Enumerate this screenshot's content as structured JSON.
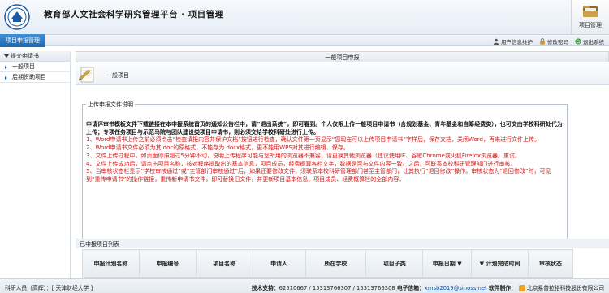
{
  "header": {
    "title": "教育部人文社会科学研究管理平台 · 项目管理",
    "module_button_label": "项目管理"
  },
  "nav": {
    "active_tab": "项目申报管理",
    "links": [
      {
        "label": "用户信息维护",
        "icon": "user-icon"
      },
      {
        "label": "修改密码",
        "icon": "lock-icon"
      },
      {
        "label": "退出系统",
        "icon": "power-icon"
      }
    ]
  },
  "sidebar": {
    "heading": "提交申请书",
    "items": [
      {
        "label": "一般项目"
      },
      {
        "label": "后期资助项目"
      }
    ]
  },
  "main": {
    "title": "一般项目申报",
    "section_label": "一般项目",
    "notice": {
      "legend": "上传申报文件说明",
      "intro": "申请评审书模板文件下载链接在本申报系统首页的通知公告栏中，请“退出系统”，即可看到。个人仅限上传一般项目申请书（含规划基金、青年基金和自筹经费类），也可交由学校科研处代为上传；专项任务项目与示范马院与团队建设类项目申请书，则必须交给学校科研处进行上传。",
      "items": [
        "1、Word申请书上传之前必须点击“检查填报内容并保护文档”按钮进行检查，确认文件第一页显示“您现在可以上传项目申请书”字样后，保存文档，关闭Word，再来进行文件上传。",
        "2、Word申请书文件必须为其.doc的原格式，不能存为.docx格式，更不能用WPS对其进行编辑、保存。",
        "3、文件上传过程中，如页面停滞超过5分钟不动，说明上传程序可能与您所用的浏览器不兼容，请更换其他浏览器（建议使用IE、谷歌Chrome或火狐Firefox浏览器）重试。",
        "4、文件上传成功后，请点击项目名称，核对程序提取出的基本信息，项目成员，经费概算各栏文字，数据是否与文件内容一致。之后，可联系本校科研管理部门进行审核。",
        "5、当审核状态栏显示“学校审核通过”或“主管部门审核通过”后，如果还要修改文件，须联系本校科研管理部门甚至主管部门，让其执行“退回修改”操作。审核状态为“退回修改”时，可见到“重传申请书”的操作链接，重传新申请书文件，即可替换旧文件，并更新项目基本信息、项目成员、经费概算栏的全部内容。"
      ]
    },
    "list_title": "已申报项目列表",
    "table_headers": [
      "申报计划名称",
      "申报编号",
      "项目名称",
      "申请人",
      "所在学校",
      "项目子类",
      "申报日期",
      "计划完成时间",
      "审核状态"
    ],
    "sortable_columns": [
      6,
      7
    ]
  },
  "footer": {
    "user_info": "科研人员（高辉）：[ 天津财经大学 ]",
    "support_label": "技术支持：",
    "support_phones": "62510667 / 15313766307 / 15313766308",
    "email_label": "电子信箱：",
    "email": "xmsb2019@sinoss.net",
    "software_label": "软件制作：",
    "software_company": "北京易普拉格科技股份有限公司"
  },
  "colors": {
    "accent": "#1f67b2",
    "notice_red": "#d01818"
  }
}
